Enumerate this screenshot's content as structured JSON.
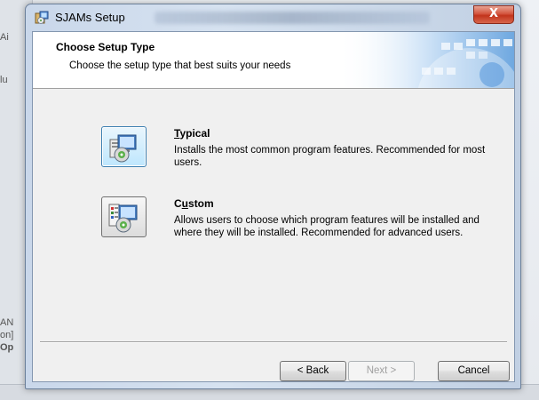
{
  "window": {
    "title": "SJAMs Setup",
    "close_glyph": "X"
  },
  "background": {
    "snippets": [
      "Ai",
      "lu",
      "AN",
      "on]",
      "Op"
    ]
  },
  "banner": {
    "title": "Choose Setup Type",
    "subtitle": "Choose the setup type that best suits your needs"
  },
  "options": [
    {
      "title_accel": "T",
      "title_rest": "ypical",
      "description": "Installs the most common program features. Recommended for most users.",
      "icon": "typical-setup-icon",
      "selected": true
    },
    {
      "title_pre": "C",
      "title_accel": "u",
      "title_rest": "stom",
      "description": "Allows users to choose which program features will be installed and where they will be installed. Recommended for advanced users.",
      "icon": "custom-setup-icon",
      "selected": false
    }
  ],
  "buttons": {
    "back": "< Back",
    "next": "Next >",
    "cancel": "Cancel"
  },
  "colors": {
    "close_button": "#c2341c",
    "selected_option": "#bee6fd",
    "banner_art": "#4a90d9"
  }
}
